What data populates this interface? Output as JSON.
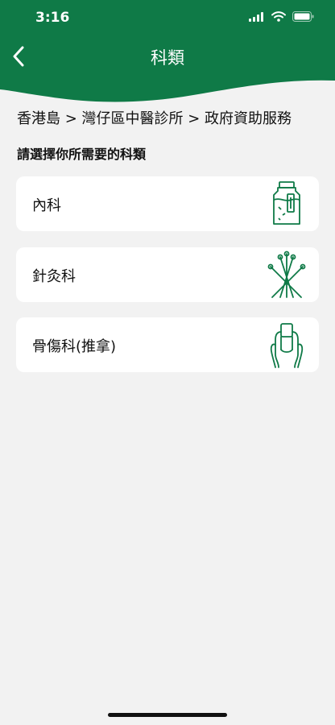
{
  "status_bar": {
    "time": "3:16"
  },
  "header": {
    "title": "科類"
  },
  "breadcrumb": "香港島 > 灣仔區中醫診所 > 政府資助服務",
  "instruction": "請選擇你所需要的科類",
  "categories": [
    {
      "label": "內科",
      "icon": "medicine-bottle-icon"
    },
    {
      "label": "針灸科",
      "icon": "acupuncture-needles-icon"
    },
    {
      "label": "骨傷科(推拿)",
      "icon": "massage-hands-icon"
    }
  ],
  "colors": {
    "brand_green": "#0f7a47",
    "background": "#f2f2f2",
    "card": "#ffffff"
  }
}
